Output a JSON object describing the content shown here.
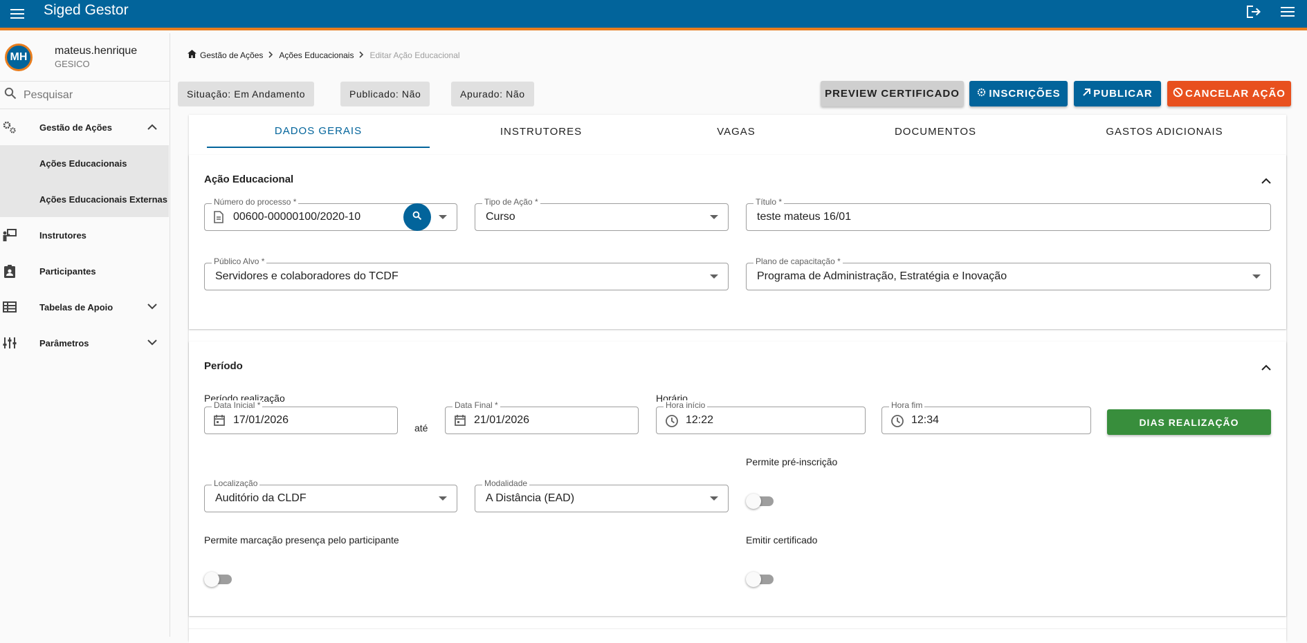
{
  "app": {
    "title": "Siged Gestor"
  },
  "user": {
    "initials": "MH",
    "name": "mateus.henrique",
    "org": "GESICO"
  },
  "sidebar": {
    "search_placeholder": "Pesquisar",
    "items": [
      {
        "label": "Gestão de Ações",
        "icon": "gears-icon"
      },
      {
        "label": "Ações Educacionais"
      },
      {
        "label": "Ações Educacionais Externas"
      },
      {
        "label": "Instrutores",
        "icon": "instructor-icon"
      },
      {
        "label": "Participantes",
        "icon": "badge-icon"
      },
      {
        "label": "Tabelas de Apoio",
        "icon": "table-icon"
      },
      {
        "label": "Parâmetros",
        "icon": "sliders-icon"
      }
    ]
  },
  "breadcrumb": {
    "home": "Gestão de Ações",
    "level2": "Ações Educacionais",
    "current": "Editar Ação Educacional"
  },
  "status": {
    "situacao": "Situação: Em Andamento",
    "publicado": "Publicado: Não",
    "apurado": "Apurado: Não"
  },
  "actions": {
    "preview": "PREVIEW CERTIFICADO",
    "inscricoes": "INSCRIÇÕES",
    "publicar": "PUBLICAR",
    "cancelar": "CANCELAR AÇÃO"
  },
  "colors": {
    "primary": "#02649b",
    "accent": "#e87d1e",
    "danger": "#e8501e",
    "success": "#388e3c"
  },
  "tabs": [
    "DADOS GERAIS",
    "INSTRUTORES",
    "VAGAS",
    "DOCUMENTOS",
    "GASTOS ADICIONAIS"
  ],
  "acao": {
    "title": "Ação Educacional",
    "numero_label": "Número do processo *",
    "numero_value": "00600-00000100/2020-10",
    "tipo_label": "Tipo de Ação *",
    "tipo_value": "Curso",
    "titulo_label": "Título *",
    "titulo_value": "teste mateus 16/01",
    "publico_label": "Público Alvo *",
    "publico_value": "Servidores e colaboradores do TCDF",
    "plano_label": "Plano de capacitação *",
    "plano_value": "Programa de Administração, Estratégia e Inovação"
  },
  "periodo": {
    "title": "Período",
    "realizacao_label": "Período realização",
    "data_inicial_label": "Data Inicial *",
    "data_inicial_value": "17/01/2026",
    "ate": "até",
    "data_final_label": "Data Final *",
    "data_final_value": "21/01/2026",
    "horario_label": "Horário",
    "hora_inicio_label": "Hora início",
    "hora_inicio_value": "12:22",
    "hora_fim_label": "Hora fim",
    "hora_fim_value": "12:34",
    "dias_button": "DIAS REALIZAÇÃO",
    "localizacao_label": "Localização",
    "localizacao_value": "Auditório da CLDF",
    "modalidade_label": "Modalidade",
    "modalidade_value": "A Distância (EAD)",
    "pre_inscricao_label": "Permite pré-inscrição",
    "presenca_label": "Permite marcação presença pelo participante",
    "certificado_label": "Emitir certificado"
  }
}
